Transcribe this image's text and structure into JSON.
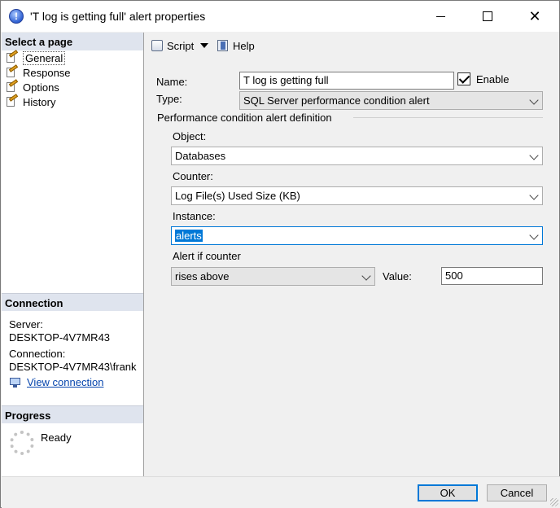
{
  "window": {
    "title": "'T log is getting full' alert properties"
  },
  "left_pane": {
    "select_page_header": "Select a page",
    "pages": [
      {
        "label": "General",
        "selected": true
      },
      {
        "label": "Response",
        "selected": false
      },
      {
        "label": "Options",
        "selected": false
      },
      {
        "label": "History",
        "selected": false
      }
    ],
    "connection_header": "Connection",
    "server_label": "Server:",
    "server_value": "DESKTOP-4V7MR43",
    "connection_label": "Connection:",
    "connection_value": "DESKTOP-4V7MR43\\frank",
    "view_connection_link": "View connection",
    "progress_header": "Progress",
    "progress_status": "Ready"
  },
  "toolbar": {
    "script_label": "Script",
    "help_label": "Help"
  },
  "form": {
    "name_label": "Name:",
    "name_value": "T log is getting full",
    "enable_label": "Enable",
    "enable_checked": true,
    "type_label": "Type:",
    "type_value": "SQL Server performance condition alert",
    "group_title": "Performance condition alert definition",
    "object_label": "Object:",
    "object_value": "Databases",
    "counter_label": "Counter:",
    "counter_value": "Log File(s) Used Size (KB)",
    "instance_label": "Instance:",
    "instance_value": "alerts",
    "alert_if_label": "Alert if counter",
    "alert_if_value": "rises above",
    "value_label": "Value:",
    "value_value": "500"
  },
  "buttons": {
    "ok": "OK",
    "cancel": "Cancel"
  },
  "colors": {
    "accent": "#0078d7",
    "section_header_bg": "#dfe4ee",
    "link": "#0645ad"
  }
}
